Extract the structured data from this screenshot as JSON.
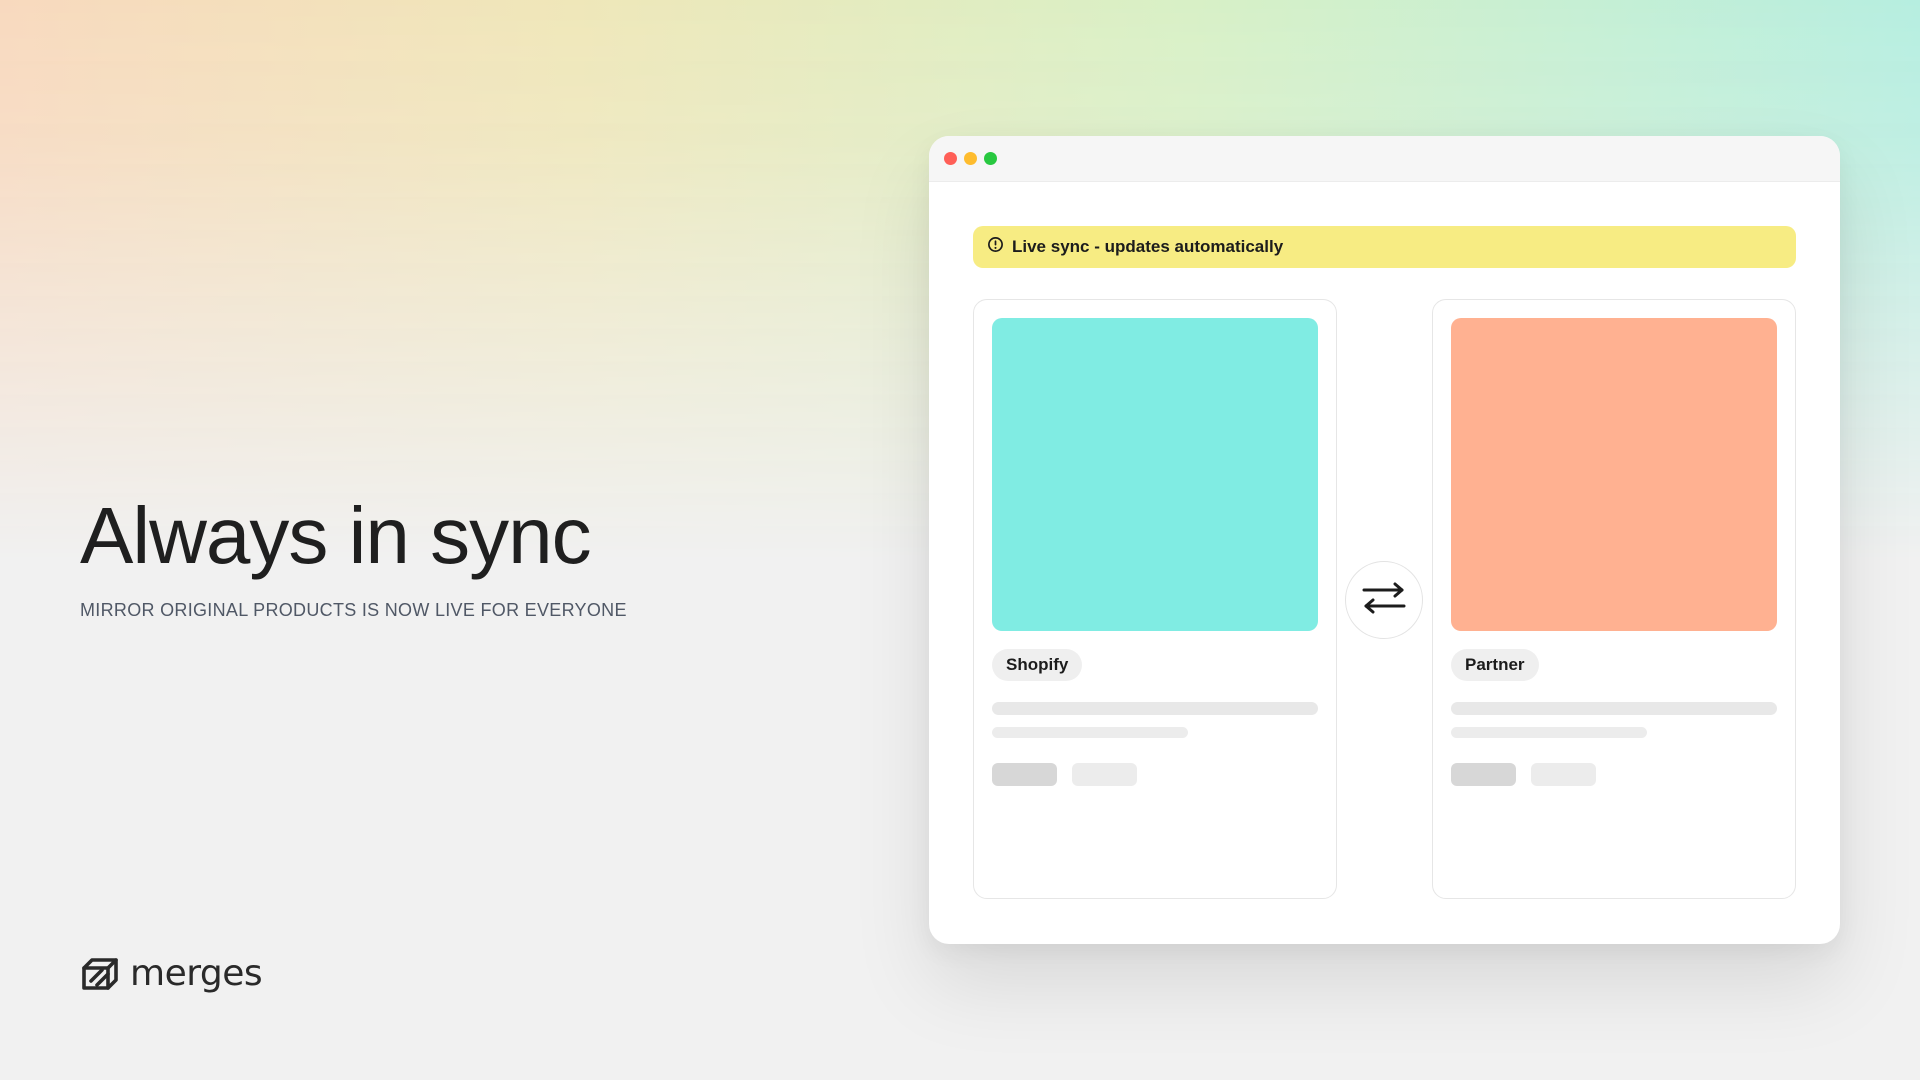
{
  "hero": {
    "title": "Always in sync",
    "subtitle": "MIRROR ORIGINAL PRODUCTS IS NOW LIVE FOR EVERYONE"
  },
  "brand": {
    "name": "merges",
    "icon": "merges-logo-icon"
  },
  "window": {
    "traffic_lights": {
      "close_color": "#ff5f57",
      "minimize_color": "#febc2e",
      "maximize_color": "#28c840"
    },
    "banner": {
      "icon": "info-icon",
      "text": "Live sync - updates automatically",
      "color": "#f7ec83"
    },
    "cards": [
      {
        "label": "Shopify",
        "image_color": "#80ece3"
      },
      {
        "label": "Partner",
        "image_color": "#ffb191"
      }
    ],
    "swap_icon": "swap-arrows-icon"
  },
  "colors": {
    "gradient": [
      "#f8d9be",
      "#efe7b9",
      "#d8f0c6",
      "#b6eee0"
    ],
    "background": "#f1f1f1"
  }
}
